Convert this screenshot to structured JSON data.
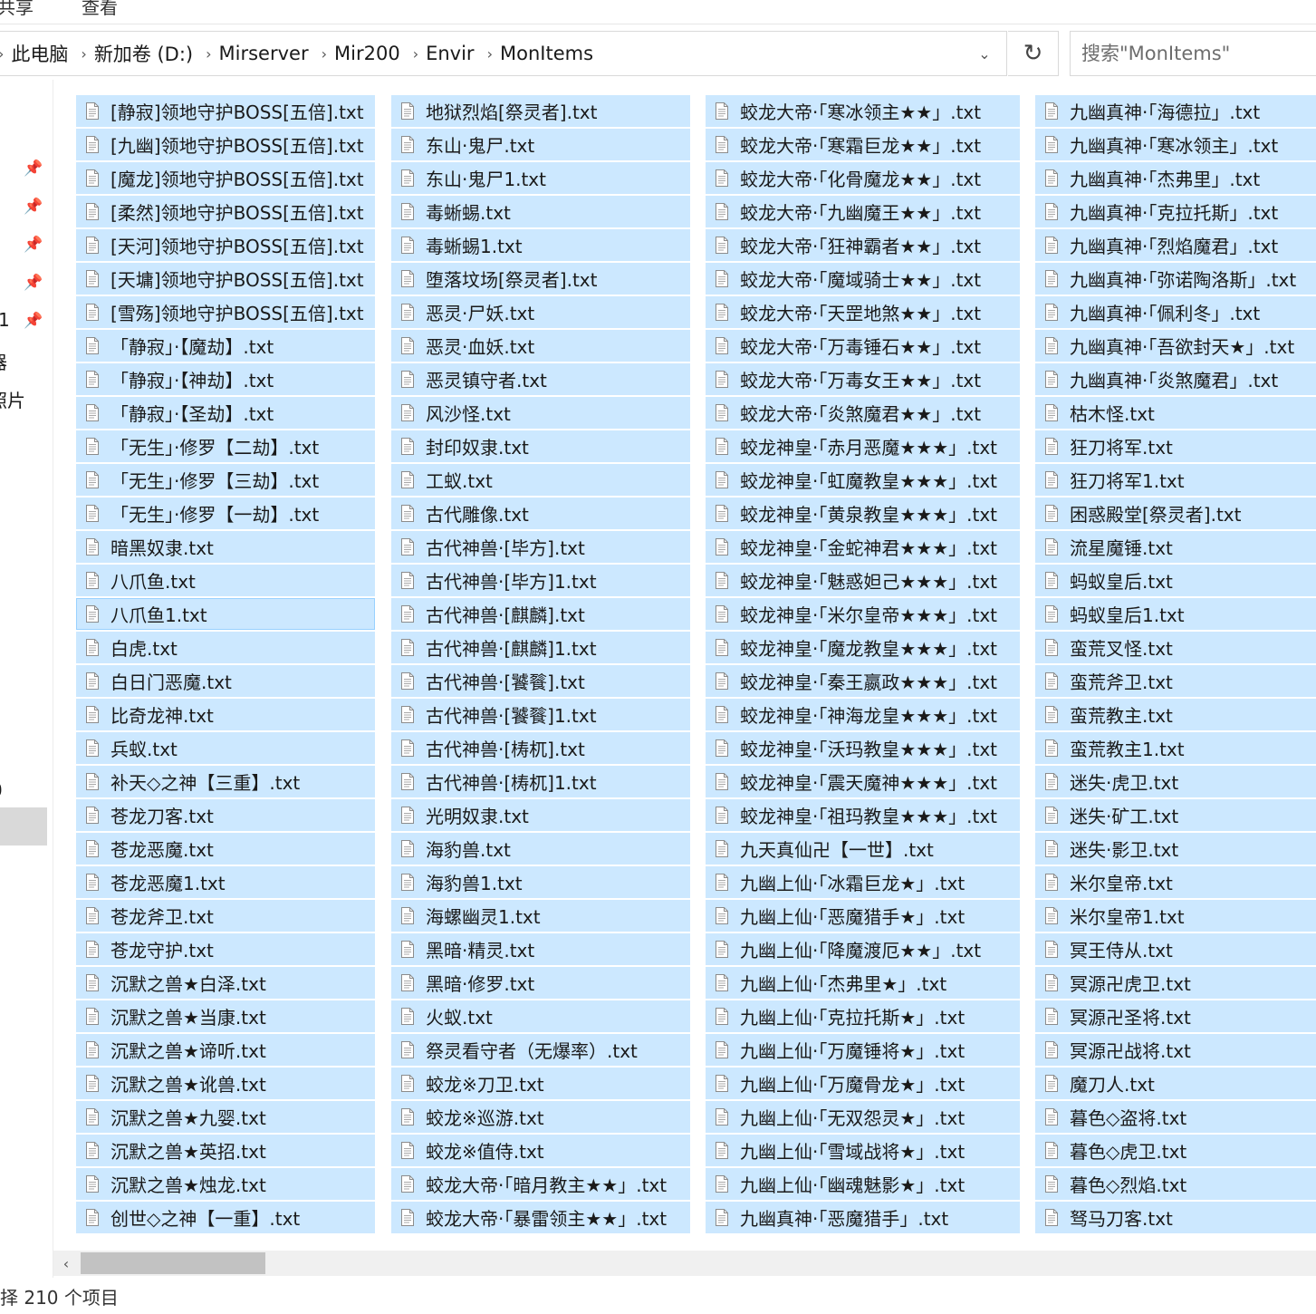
{
  "ribbon": {
    "tabs": [
      "共享",
      "查看"
    ]
  },
  "address": {
    "segments": [
      "此电脑",
      "新加卷 (D:)",
      "Mirserver",
      "Mir200",
      "Envir",
      "MonItems"
    ]
  },
  "search": {
    "placeholder": "搜索\"MonItems\""
  },
  "nav": {
    "fragments": [
      "1",
      "器",
      "照片",
      "0"
    ]
  },
  "status": {
    "text": "择 210 个项目"
  },
  "icons": {
    "breadcrumb_sep": "chevron-right-icon",
    "address_dropdown": "chevron-down-icon",
    "refresh": "refresh-icon",
    "pin": "pin-icon",
    "file": "text-file-icon",
    "scroll_left": "chevron-left-icon"
  },
  "colors": {
    "selection_bg": "#cce8ff",
    "selection_border": "#99d1ff",
    "nav_selected": "#d9d9d9"
  },
  "files": {
    "columns": [
      [
        "[静寂]领地守护BOSS[五倍].txt",
        "[九幽]领地守护BOSS[五倍].txt",
        "[魔龙]领地守护BOSS[五倍].txt",
        "[柔然]领地守护BOSS[五倍].txt",
        "[天河]领地守护BOSS[五倍].txt",
        "[天墉]领地守护BOSS[五倍].txt",
        "[雪殇]领地守护BOSS[五倍].txt",
        "「静寂」·【魔劫】.txt",
        "「静寂」·【神劫】.txt",
        "「静寂」·【圣劫】.txt",
        "「无生」·修罗【二劫】.txt",
        "「无生」·修罗【三劫】.txt",
        "「无生」·修罗【一劫】.txt",
        "暗黑奴隶.txt",
        "八爪鱼.txt",
        "八爪鱼1.txt",
        "白虎.txt",
        "白日门恶魔.txt",
        "比奇龙神.txt",
        "兵蚁.txt",
        "补天◇之神【三重】.txt",
        "苍龙刀客.txt",
        "苍龙恶魔.txt",
        "苍龙恶魔1.txt",
        "苍龙斧卫.txt",
        "苍龙守护.txt",
        "沉默之兽★白泽.txt",
        "沉默之兽★当康.txt",
        "沉默之兽★谛听.txt",
        "沉默之兽★讹兽.txt",
        "沉默之兽★九婴.txt",
        "沉默之兽★英招.txt",
        "沉默之兽★烛龙.txt",
        "创世◇之神【一重】.txt"
      ],
      [
        "地狱烈焰[祭灵者].txt",
        "东山·鬼尸.txt",
        "东山·鬼尸1.txt",
        "毒蜥蜴.txt",
        "毒蜥蜴1.txt",
        "堕落坟场[祭灵者].txt",
        "恶灵·尸妖.txt",
        "恶灵·血妖.txt",
        "恶灵镇守者.txt",
        "风沙怪.txt",
        "封印奴隶.txt",
        "工蚁.txt",
        "古代雕像.txt",
        "古代神兽·[毕方].txt",
        "古代神兽·[毕方]1.txt",
        "古代神兽·[麒麟].txt",
        "古代神兽·[麒麟]1.txt",
        "古代神兽·[饕餮].txt",
        "古代神兽·[饕餮]1.txt",
        "古代神兽·[梼杌].txt",
        "古代神兽·[梼杌]1.txt",
        "光明奴隶.txt",
        "海豹兽.txt",
        "海豹兽1.txt",
        "海螺幽灵1.txt",
        "黑暗·精灵.txt",
        "黑暗·修罗.txt",
        "火蚁.txt",
        "祭灵看守者（无爆率）.txt",
        "蛟龙※刀卫.txt",
        "蛟龙※巡游.txt",
        "蛟龙※值侍.txt",
        "蛟龙大帝·「暗月教主★★」.txt",
        "蛟龙大帝·「暴雷领主★★」.txt"
      ],
      [
        "蛟龙大帝·「寒冰领主★★」.txt",
        "蛟龙大帝·「寒霜巨龙★★」.txt",
        "蛟龙大帝·「化骨魔龙★★」.txt",
        "蛟龙大帝·「九幽魔王★★」.txt",
        "蛟龙大帝·「狂神霸者★★」.txt",
        "蛟龙大帝·「魔域骑士★★」.txt",
        "蛟龙大帝·「天罡地煞★★」.txt",
        "蛟龙大帝·「万毒锤石★★」.txt",
        "蛟龙大帝·「万毒女王★★」.txt",
        "蛟龙大帝·「炎煞魔君★★」.txt",
        "蛟龙神皇·「赤月恶魔★★★」.txt",
        "蛟龙神皇·「虹魔教皇★★★」.txt",
        "蛟龙神皇·「黄泉教皇★★★」.txt",
        "蛟龙神皇·「金蛇神君★★★」.txt",
        "蛟龙神皇·「魅惑妲己★★★」.txt",
        "蛟龙神皇·「米尔皇帝★★★」.txt",
        "蛟龙神皇·「魔龙教皇★★★」.txt",
        "蛟龙神皇·「秦王嬴政★★★」.txt",
        "蛟龙神皇·「神海龙皇★★★」.txt",
        "蛟龙神皇·「沃玛教皇★★★」.txt",
        "蛟龙神皇·「震天魔神★★★」.txt",
        "蛟龙神皇·「祖玛教皇★★★」.txt",
        "九天真仙卍【一世】.txt",
        "九幽上仙·「冰霜巨龙★」.txt",
        "九幽上仙·「恶魔猎手★」.txt",
        "九幽上仙·「降魔渡厄★★」.txt",
        "九幽上仙·「杰弗里★」.txt",
        "九幽上仙·「克拉托斯★」.txt",
        "九幽上仙·「万魔锤将★」.txt",
        "九幽上仙·「万魔骨龙★」.txt",
        "九幽上仙·「无双怨灵★」.txt",
        "九幽上仙·「雪域战将★」.txt",
        "九幽上仙·「幽魂魅影★」.txt",
        "九幽真神·「恶魔猎手」.txt"
      ],
      [
        "九幽真神·「海德拉」.txt",
        "九幽真神·「寒冰领主」.txt",
        "九幽真神·「杰弗里」.txt",
        "九幽真神·「克拉托斯」.txt",
        "九幽真神·「烈焰魔君」.txt",
        "九幽真神·「弥诺陶洛斯」.txt",
        "九幽真神·「佩利冬」.txt",
        "九幽真神·「吾欲封天★」.txt",
        "九幽真神·「炎煞魔君」.txt",
        "枯木怪.txt",
        "狂刀将军.txt",
        "狂刀将军1.txt",
        "困惑殿堂[祭灵者].txt",
        "流星魔锤.txt",
        "蚂蚁皇后.txt",
        "蚂蚁皇后1.txt",
        "蛮荒叉怪.txt",
        "蛮荒斧卫.txt",
        "蛮荒教主.txt",
        "蛮荒教主1.txt",
        "迷失·虎卫.txt",
        "迷失·矿工.txt",
        "迷失·影卫.txt",
        "米尔皇帝.txt",
        "米尔皇帝1.txt",
        "冥王侍从.txt",
        "冥源卍虎卫.txt",
        "冥源卍圣将.txt",
        "冥源卍战将.txt",
        "魔刀人.txt",
        "暮色◇盗将.txt",
        "暮色◇虎卫.txt",
        "暮色◇烈焰.txt",
        "驽马刀客.txt"
      ]
    ]
  }
}
